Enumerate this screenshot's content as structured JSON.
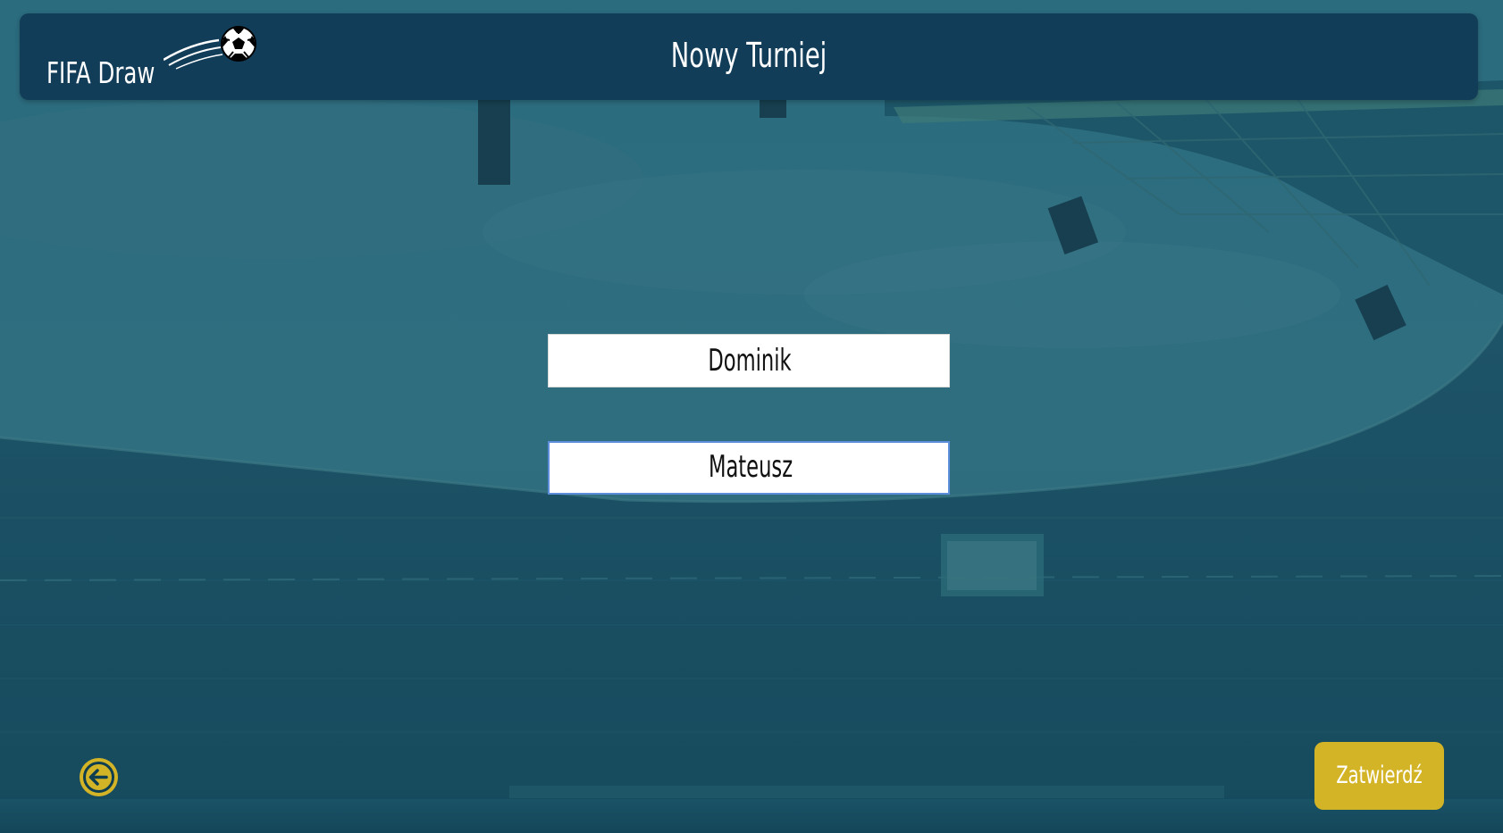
{
  "app": {
    "logo_text": "FIFA Draw",
    "page_title": "Nowy Turniej"
  },
  "background": {
    "scene": "stadium-photo",
    "overlay_color": "#1f5f72"
  },
  "colors": {
    "header_bg": "#123d59",
    "accent": "#d4b427",
    "text_light": "#ffffff",
    "focus_border": "#5b8ddb"
  },
  "form": {
    "players": [
      {
        "value": "Dominik"
      },
      {
        "value": "Mateusz"
      }
    ]
  },
  "actions": {
    "back_icon": "arrow-left-icon",
    "confirm_label": "Zatwierdź"
  }
}
